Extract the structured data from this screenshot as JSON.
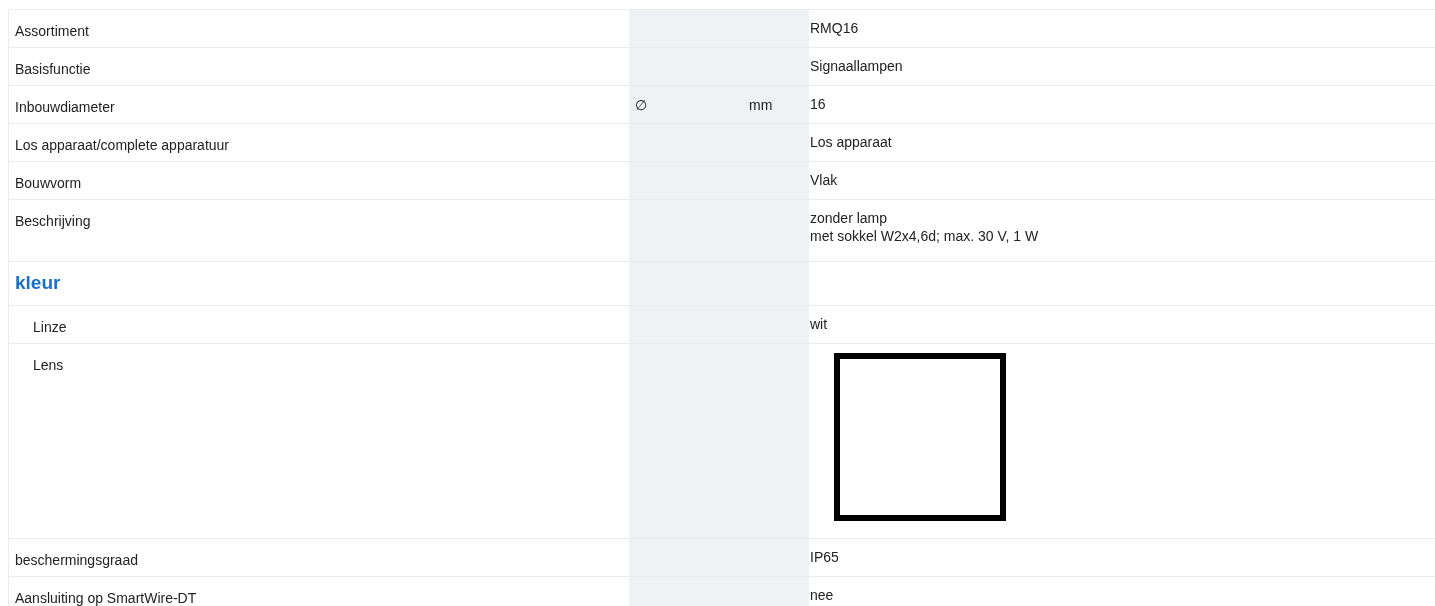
{
  "rows": [
    {
      "kind": "row",
      "label": "Assortiment",
      "value": [
        "RMQ16"
      ]
    },
    {
      "kind": "row",
      "label": "Basisfunctie",
      "value": [
        "Signaallampen"
      ]
    },
    {
      "kind": "row",
      "label": "Inbouwdiameter",
      "symbol": "∅",
      "unit": "mm",
      "value": [
        "16"
      ]
    },
    {
      "kind": "row",
      "label": "Los apparaat/complete apparatuur",
      "value": [
        "Los apparaat"
      ]
    },
    {
      "kind": "row",
      "label": "Bouwvorm",
      "value": [
        "Vlak"
      ]
    },
    {
      "kind": "row",
      "label": "Beschrijving",
      "value": [
        "zonder lamp",
        "met sokkel W2x4,6d; max. 30 V, 1 W"
      ]
    },
    {
      "kind": "section",
      "label": "kleur"
    },
    {
      "kind": "subrow",
      "label": "Linze",
      "value": [
        "wit"
      ]
    },
    {
      "kind": "swatch",
      "label": "Lens",
      "color": "#ffffff"
    },
    {
      "kind": "row",
      "label": "beschermingsgraad",
      "value": [
        "IP65"
      ]
    },
    {
      "kind": "row",
      "label": "Aansluiting op SmartWire-DT",
      "value": [
        "nee"
      ]
    }
  ]
}
